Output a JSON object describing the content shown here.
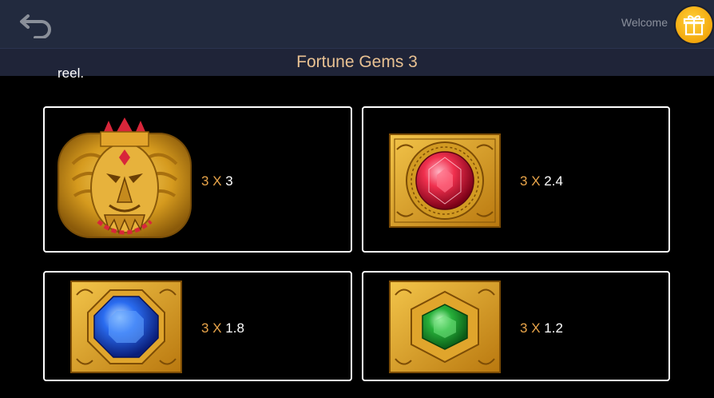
{
  "header": {
    "welcome": "Welcome",
    "title": "Fortune Gems 3"
  },
  "intro_cutoff": "reel.",
  "symbols": [
    {
      "name": "Golden Garuda Mask",
      "count": "3",
      "x": "X",
      "multiplier": "3"
    },
    {
      "name": "Red Gem",
      "count": "3",
      "x": "X",
      "multiplier": "2.4"
    },
    {
      "name": "Blue Gem",
      "count": "3",
      "x": "X",
      "multiplier": "1.8"
    },
    {
      "name": "Green Gem",
      "count": "3",
      "x": "X",
      "multiplier": "1.2"
    }
  ],
  "colors": {
    "topbar": "#222a3e",
    "title": "#e8c192",
    "accent_orange": "#e8a44a",
    "gift_gold": "#f3a70c"
  },
  "icons": [
    "back-arrow-icon",
    "gift-icon"
  ]
}
